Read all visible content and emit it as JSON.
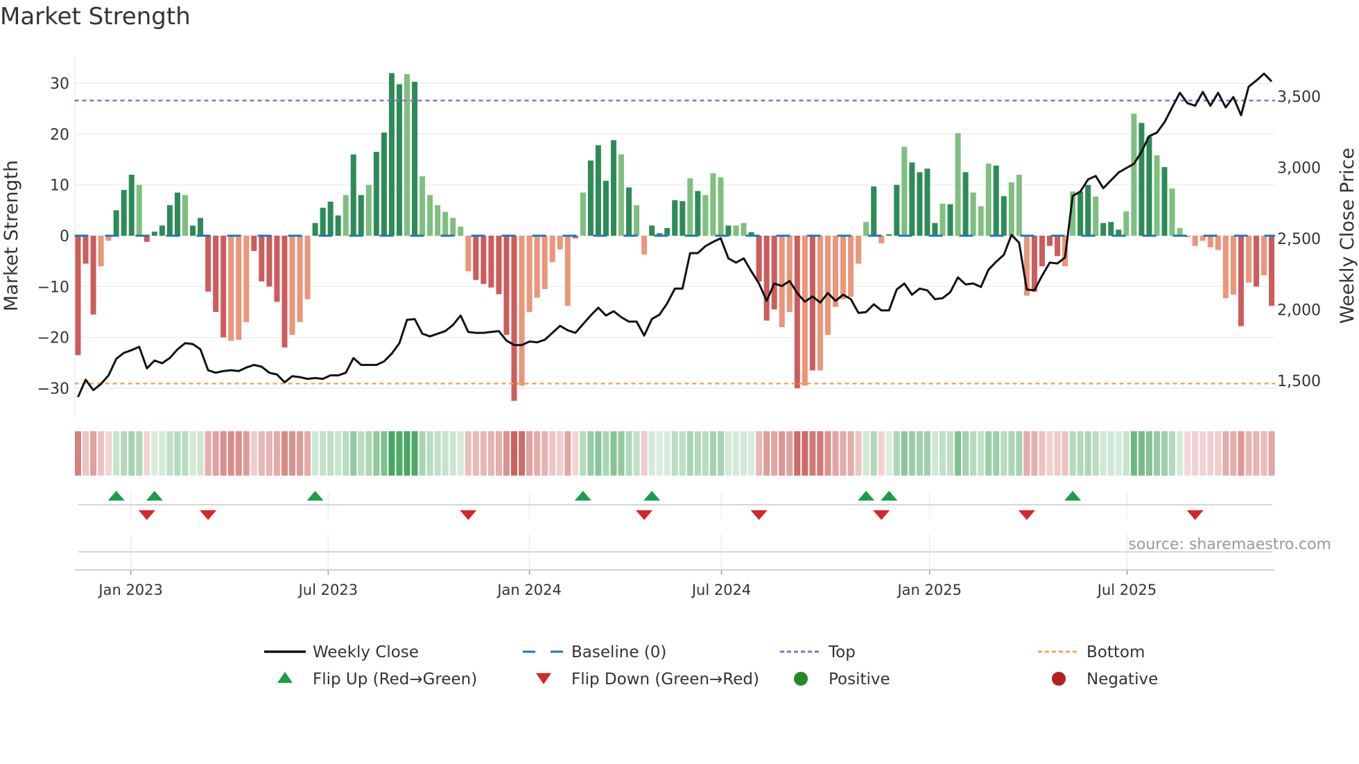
{
  "title": "Market Strength",
  "source": "source: sharemaestro.com",
  "colors": {
    "bar_up_strong": "#2e8b57",
    "bar_up_weak": "#7fbf7f",
    "bar_down_strong": "#cd5c5c",
    "bar_down_weak": "#e9967a",
    "price": "#111111",
    "baseline": "#1f77b4",
    "top": "#9467d6",
    "bottom": "#f4a460",
    "flip_up": "#1a9e4a",
    "flip_down": "#d62728",
    "positive": "#228b22",
    "negative": "#b22222"
  },
  "legend": [
    {
      "key": "weekly_close",
      "label": "Weekly Close",
      "symbol": "line"
    },
    {
      "key": "baseline",
      "label": "Baseline (0)",
      "symbol": "dash"
    },
    {
      "key": "top",
      "label": "Top",
      "symbol": "dot-purple"
    },
    {
      "key": "bottom",
      "label": "Bottom",
      "symbol": "dot-orange"
    },
    {
      "key": "flip_up",
      "label": "Flip Up (Red→Green)",
      "symbol": "tri-up"
    },
    {
      "key": "flip_down",
      "label": "Flip Down (Green→Red)",
      "symbol": "tri-down"
    },
    {
      "key": "positive",
      "label": "Positive",
      "symbol": "dot-green"
    },
    {
      "key": "negative",
      "label": "Negative",
      "symbol": "dot-red"
    }
  ],
  "chart_data": {
    "type": "bar",
    "title": "Market Strength",
    "ylabel": "Market Strength",
    "y2label": "Weekly Close Price",
    "ylim": [
      -35,
      35
    ],
    "y2lim": [
      1300,
      3800
    ],
    "yticks": [
      30,
      20,
      10,
      0,
      -10,
      -20,
      -30
    ],
    "y2ticks": [
      {
        "v": 3500,
        "label": "3,500"
      },
      {
        "v": 3000,
        "label": "3,000"
      },
      {
        "v": 2500,
        "label": "2,500"
      },
      {
        "v": 2000,
        "label": "2,000"
      },
      {
        "v": 1500,
        "label": "1,500"
      }
    ],
    "xticks": [
      {
        "week": 6.9,
        "label": "Jan 2023"
      },
      {
        "week": 32.7,
        "label": "Jul 2023"
      },
      {
        "week": 59,
        "label": "Jan 2024"
      },
      {
        "week": 84.1,
        "label": "Jul 2024"
      },
      {
        "week": 111.3,
        "label": "Jan 2025"
      },
      {
        "week": 137.1,
        "label": "Jul 2025"
      }
    ],
    "top_level": 26.6,
    "bottom_level": -29.1,
    "grid": true,
    "legend_position": "bottom",
    "strength": [
      -23.5,
      -5.5,
      -15.5,
      -6,
      -1,
      5,
      9,
      12,
      10,
      -1.2,
      0.8,
      2,
      6,
      8.5,
      8,
      2,
      3.5,
      -11,
      -15,
      -20,
      -20.7,
      -20.5,
      -17,
      -3,
      -9,
      -10,
      -13,
      -22,
      -19.5,
      -17,
      -12.5,
      2.5,
      5.5,
      6.7,
      4,
      8,
      16,
      8,
      10,
      16.5,
      20.3,
      32,
      29.8,
      31.8,
      30.3,
      11.7,
      8,
      6,
      4.7,
      3.5,
      1.8,
      -7,
      -8.7,
      -9.5,
      -10.2,
      -11.5,
      -19.5,
      -32.5,
      -29.5,
      -15,
      -12.2,
      -10.5,
      -5.2,
      -2.7,
      -13.8,
      -0.5,
      8.5,
      14.8,
      17.8,
      10.8,
      18.8,
      16,
      9.5,
      6,
      -3.7,
      2,
      0.5,
      1.5,
      7,
      6.8,
      11.3,
      8.8,
      8,
      12.3,
      11.5,
      2,
      2,
      2.5,
      0.7,
      -9,
      -16.7,
      -14.5,
      -18,
      -15,
      -30,
      -29.5,
      -26.5,
      -26.5,
      -19.5,
      -14,
      -12.5,
      -12,
      -5.5,
      2.7,
      9.7,
      -1.5,
      0.3,
      10,
      17.5,
      14.4,
      12.5,
      13.2,
      2.5,
      6.3,
      6.2,
      20.2,
      12.5,
      8.5,
      5.8,
      14.2,
      13.8,
      7.8,
      10.5,
      12,
      -11.8,
      -11,
      -6,
      -2,
      -4,
      -6,
      8.7,
      8.7,
      10,
      7.7,
      2.5,
      2.7,
      1.2,
      4.8,
      24,
      22.2,
      19.5,
      15.8,
      13.5,
      9.3,
      1.5,
      -0.3,
      -2,
      -1,
      -2.3,
      -2.8,
      -12.3,
      -11.6,
      -17.8,
      -9.2,
      -10,
      -7.8,
      -13.8
    ],
    "strength_shade": "dddlldddldddddldddddllldddddlllddddlddlddddldlllllllddddddllllllldlddddldlldddddldllldllddddlldldllllllldlddlddddldldlllddlllddddllddldddllddldllllllllldldldldldldld",
    "weekly_close": [
      1383,
      1505,
      1432,
      1475,
      1536,
      1652,
      1694,
      1713,
      1737,
      1585,
      1640,
      1621,
      1658,
      1719,
      1762,
      1756,
      1719,
      1572,
      1554,
      1566,
      1572,
      1566,
      1591,
      1609,
      1597,
      1554,
      1542,
      1487,
      1530,
      1523,
      1511,
      1517,
      1511,
      1536,
      1536,
      1554,
      1658,
      1609,
      1609,
      1609,
      1634,
      1688,
      1762,
      1926,
      1932,
      1829,
      1810,
      1829,
      1847,
      1890,
      1957,
      1841,
      1835,
      1835,
      1841,
      1847,
      1780,
      1749,
      1749,
      1774,
      1768,
      1786,
      1835,
      1884,
      1853,
      1835,
      1896,
      1957,
      2012,
      1957,
      1987,
      1945,
      1914,
      1914,
      1816,
      1932,
      1963,
      2042,
      2146,
      2146,
      2396,
      2396,
      2445,
      2475,
      2500,
      2359,
      2329,
      2359,
      2268,
      2182,
      2060,
      2182,
      2164,
      2200,
      2115,
      2054,
      2091,
      2048,
      2115,
      2060,
      2103,
      2072,
      1975,
      1981,
      2036,
      1993,
      1993,
      2140,
      2182,
      2103,
      2146,
      2134,
      2072,
      2079,
      2121,
      2225,
      2176,
      2182,
      2158,
      2280,
      2335,
      2384,
      2524,
      2469,
      2140,
      2134,
      2237,
      2329,
      2323,
      2365,
      2798,
      2829,
      2914,
      2939,
      2853,
      2908,
      2963,
      2994,
      3024,
      3110,
      3219,
      3243,
      3317,
      3421,
      3524,
      3451,
      3433,
      3530,
      3433,
      3524,
      3421,
      3494,
      3366,
      3567,
      3610,
      3659,
      3604
    ],
    "flip_up_weeks": [
      5,
      10,
      31,
      66,
      75,
      103,
      106,
      130
    ],
    "flip_down_weeks": [
      9,
      17,
      51,
      74,
      89,
      105,
      124,
      146
    ]
  }
}
